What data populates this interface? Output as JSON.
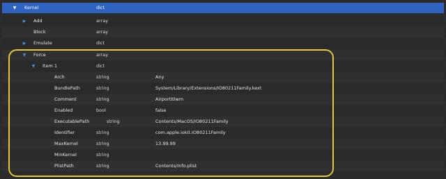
{
  "rows": [
    {
      "key": "Kernel",
      "type": "dict",
      "value": "",
      "disclosure": "▼"
    },
    {
      "key": "Add",
      "type": "array",
      "value": "",
      "disclosure": "▶"
    },
    {
      "key": "Block",
      "type": "array",
      "value": "",
      "disclosure": ""
    },
    {
      "key": "Emulate",
      "type": "dict",
      "value": "",
      "disclosure": "▶"
    },
    {
      "key": "Force",
      "type": "array",
      "value": "",
      "disclosure": "▼"
    },
    {
      "key": "Item 1",
      "type": "dict",
      "value": "",
      "disclosure": "▼"
    },
    {
      "key": "Arch",
      "type": "string",
      "value": "Any",
      "disclosure": ""
    },
    {
      "key": "BundlePath",
      "type": "string",
      "value": "System/Library/Extensions/IO80211Family.kext",
      "disclosure": ""
    },
    {
      "key": "Comment",
      "type": "string",
      "value": "AirportItlwm",
      "disclosure": ""
    },
    {
      "key": "Enabled",
      "type": "bool",
      "value": "false",
      "disclosure": ""
    },
    {
      "key": "ExecutablePath",
      "type": "string",
      "value": "Contents/MacOS/IO80211Family",
      "disclosure": ""
    },
    {
      "key": "Identifier",
      "type": "string",
      "value": "com.apple.iokit.IO80211Family",
      "disclosure": ""
    },
    {
      "key": "MaxKernel",
      "type": "string",
      "value": "13.99.99",
      "disclosure": ""
    },
    {
      "key": "MinKernel",
      "type": "string",
      "value": "",
      "disclosure": ""
    },
    {
      "key": "PlistPath",
      "type": "string",
      "value": "Contents/Info.plist",
      "disclosure": ""
    }
  ],
  "colors": {
    "selection": "#2f63c1",
    "highlight_outline": "#e4c83a",
    "disclosure": "#4a90e2"
  }
}
